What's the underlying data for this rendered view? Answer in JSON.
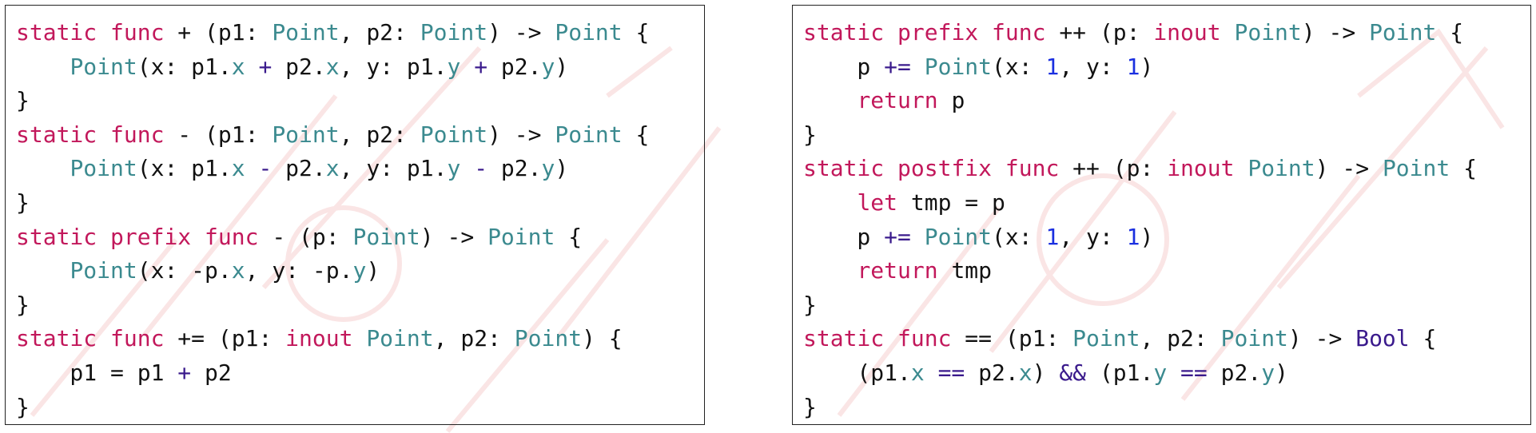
{
  "colors": {
    "keyword": "#c2185b",
    "type": "#3b8a8f",
    "number": "#1a2fe0",
    "operator": "#3a1a8c",
    "plain": "#111111",
    "border": "#222222",
    "watermark": "#f3c4c4"
  },
  "panels": [
    {
      "id": "left",
      "lines": [
        [
          [
            "kw",
            "static"
          ],
          [
            "pl",
            " "
          ],
          [
            "kw",
            "func"
          ],
          [
            "pl",
            " + (p1: "
          ],
          [
            "ty",
            "Point"
          ],
          [
            "pl",
            ", p2: "
          ],
          [
            "ty",
            "Point"
          ],
          [
            "pl",
            ") -> "
          ],
          [
            "ty",
            "Point"
          ],
          [
            "pl",
            " {"
          ]
        ],
        [
          [
            "pl",
            "    "
          ],
          [
            "ty",
            "Point"
          ],
          [
            "pl",
            "(x: p1."
          ],
          [
            "ty",
            "x"
          ],
          [
            "pl",
            " "
          ],
          [
            "op",
            "+"
          ],
          [
            "pl",
            " p2."
          ],
          [
            "ty",
            "x"
          ],
          [
            "pl",
            ", y: p1."
          ],
          [
            "ty",
            "y"
          ],
          [
            "pl",
            " "
          ],
          [
            "op",
            "+"
          ],
          [
            "pl",
            " p2."
          ],
          [
            "ty",
            "y"
          ],
          [
            "pl",
            ")"
          ]
        ],
        [
          [
            "pl",
            "}"
          ]
        ],
        [
          [
            "kw",
            "static"
          ],
          [
            "pl",
            " "
          ],
          [
            "kw",
            "func"
          ],
          [
            "pl",
            " - (p1: "
          ],
          [
            "ty",
            "Point"
          ],
          [
            "pl",
            ", p2: "
          ],
          [
            "ty",
            "Point"
          ],
          [
            "pl",
            ") -> "
          ],
          [
            "ty",
            "Point"
          ],
          [
            "pl",
            " {"
          ]
        ],
        [
          [
            "pl",
            "    "
          ],
          [
            "ty",
            "Point"
          ],
          [
            "pl",
            "(x: p1."
          ],
          [
            "ty",
            "x"
          ],
          [
            "pl",
            " "
          ],
          [
            "op",
            "-"
          ],
          [
            "pl",
            " p2."
          ],
          [
            "ty",
            "x"
          ],
          [
            "pl",
            ", y: p1."
          ],
          [
            "ty",
            "y"
          ],
          [
            "pl",
            " "
          ],
          [
            "op",
            "-"
          ],
          [
            "pl",
            " p2."
          ],
          [
            "ty",
            "y"
          ],
          [
            "pl",
            ")"
          ]
        ],
        [
          [
            "pl",
            "}"
          ]
        ],
        [
          [
            "kw",
            "static"
          ],
          [
            "pl",
            " "
          ],
          [
            "kw",
            "prefix"
          ],
          [
            "pl",
            " "
          ],
          [
            "kw",
            "func"
          ],
          [
            "pl",
            " - (p: "
          ],
          [
            "ty",
            "Point"
          ],
          [
            "pl",
            ") -> "
          ],
          [
            "ty",
            "Point"
          ],
          [
            "pl",
            " {"
          ]
        ],
        [
          [
            "pl",
            "    "
          ],
          [
            "ty",
            "Point"
          ],
          [
            "pl",
            "(x: -p."
          ],
          [
            "ty",
            "x"
          ],
          [
            "pl",
            ", y: -p."
          ],
          [
            "ty",
            "y"
          ],
          [
            "pl",
            ")"
          ]
        ],
        [
          [
            "pl",
            "}"
          ]
        ],
        [
          [
            "kw",
            "static"
          ],
          [
            "pl",
            " "
          ],
          [
            "kw",
            "func"
          ],
          [
            "pl",
            " += (p1: "
          ],
          [
            "kw",
            "inout"
          ],
          [
            "pl",
            " "
          ],
          [
            "ty",
            "Point"
          ],
          [
            "pl",
            ", p2: "
          ],
          [
            "ty",
            "Point"
          ],
          [
            "pl",
            ") {"
          ]
        ],
        [
          [
            "pl",
            "    p1 = p1 "
          ],
          [
            "op",
            "+"
          ],
          [
            "pl",
            " p2"
          ]
        ],
        [
          [
            "pl",
            "}"
          ]
        ]
      ]
    },
    {
      "id": "right",
      "lines": [
        [
          [
            "kw",
            "static"
          ],
          [
            "pl",
            " "
          ],
          [
            "kw",
            "prefix"
          ],
          [
            "pl",
            " "
          ],
          [
            "kw",
            "func"
          ],
          [
            "pl",
            " ++ (p: "
          ],
          [
            "kw",
            "inout"
          ],
          [
            "pl",
            " "
          ],
          [
            "ty",
            "Point"
          ],
          [
            "pl",
            ") -> "
          ],
          [
            "ty",
            "Point"
          ],
          [
            "pl",
            " {"
          ]
        ],
        [
          [
            "pl",
            "    p "
          ],
          [
            "op",
            "+="
          ],
          [
            "pl",
            " "
          ],
          [
            "ty",
            "Point"
          ],
          [
            "pl",
            "(x: "
          ],
          [
            "num",
            "1"
          ],
          [
            "pl",
            ", y: "
          ],
          [
            "num",
            "1"
          ],
          [
            "pl",
            ")"
          ]
        ],
        [
          [
            "pl",
            "    "
          ],
          [
            "kw",
            "return"
          ],
          [
            "pl",
            " p"
          ]
        ],
        [
          [
            "pl",
            "}"
          ]
        ],
        [
          [
            "kw",
            "static"
          ],
          [
            "pl",
            " "
          ],
          [
            "kw",
            "postfix"
          ],
          [
            "pl",
            " "
          ],
          [
            "kw",
            "func"
          ],
          [
            "pl",
            " ++ (p: "
          ],
          [
            "kw",
            "inout"
          ],
          [
            "pl",
            " "
          ],
          [
            "ty",
            "Point"
          ],
          [
            "pl",
            ") -> "
          ],
          [
            "ty",
            "Point"
          ],
          [
            "pl",
            " {"
          ]
        ],
        [
          [
            "pl",
            "    "
          ],
          [
            "kw",
            "let"
          ],
          [
            "pl",
            " tmp = p"
          ]
        ],
        [
          [
            "pl",
            "    p "
          ],
          [
            "op",
            "+="
          ],
          [
            "pl",
            " "
          ],
          [
            "ty",
            "Point"
          ],
          [
            "pl",
            "(x: "
          ],
          [
            "num",
            "1"
          ],
          [
            "pl",
            ", y: "
          ],
          [
            "num",
            "1"
          ],
          [
            "pl",
            ")"
          ]
        ],
        [
          [
            "pl",
            "    "
          ],
          [
            "kw",
            "return"
          ],
          [
            "pl",
            " tmp"
          ]
        ],
        [
          [
            "pl",
            "}"
          ]
        ],
        [
          [
            "kw",
            "static"
          ],
          [
            "pl",
            " "
          ],
          [
            "kw",
            "func"
          ],
          [
            "pl",
            " == (p1: "
          ],
          [
            "ty",
            "Point"
          ],
          [
            "pl",
            ", p2: "
          ],
          [
            "ty",
            "Point"
          ],
          [
            "pl",
            ") -> "
          ],
          [
            "op",
            "Bool"
          ],
          [
            "pl",
            " {"
          ]
        ],
        [
          [
            "pl",
            "    (p1."
          ],
          [
            "ty",
            "x"
          ],
          [
            "pl",
            " "
          ],
          [
            "op",
            "=="
          ],
          [
            "pl",
            " p2."
          ],
          [
            "ty",
            "x"
          ],
          [
            "pl",
            ") "
          ],
          [
            "op",
            "&&"
          ],
          [
            "pl",
            " (p1."
          ],
          [
            "ty",
            "y"
          ],
          [
            "pl",
            " "
          ],
          [
            "op",
            "=="
          ],
          [
            "pl",
            " p2."
          ],
          [
            "ty",
            "y"
          ],
          [
            "pl",
            ")"
          ]
        ],
        [
          [
            "pl",
            "}"
          ]
        ]
      ]
    }
  ]
}
